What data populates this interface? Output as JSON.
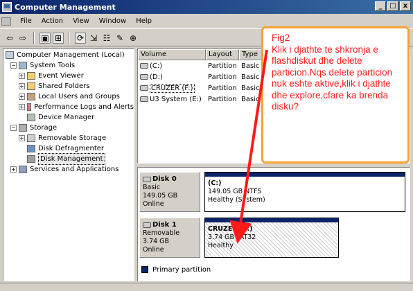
{
  "window": {
    "title": "Computer Management",
    "buttons": [
      "_",
      "□",
      "x"
    ]
  },
  "menu": [
    "File",
    "Action",
    "View",
    "Window",
    "Help"
  ],
  "toolbar": {
    "icons": [
      "back-icon",
      "forward-icon",
      "up-icon",
      "show-hide-tree-icon",
      "refresh-icon",
      "export-icon",
      "properties-icon",
      "help-icon",
      "zoom-in-icon"
    ],
    "glyphs": [
      "⇦",
      "⇨",
      "▣",
      "⊞",
      "⟳",
      "⇲",
      "☷",
      "✎",
      "⊕"
    ]
  },
  "tree": {
    "items": [
      {
        "label": "Computer Management (Local)"
      },
      {
        "label": "System Tools"
      },
      {
        "label": "Event Viewer"
      },
      {
        "label": "Shared Folders"
      },
      {
        "label": "Local Users and Groups"
      },
      {
        "label": "Performance Logs and Alerts"
      },
      {
        "label": "Device Manager"
      },
      {
        "label": "Storage"
      },
      {
        "label": "Removable Storage"
      },
      {
        "label": "Disk Defragmenter"
      },
      {
        "label": "Disk Management"
      },
      {
        "label": "Services and Applications"
      }
    ]
  },
  "volumes": {
    "headers": [
      "Volume",
      "Layout",
      "Type"
    ],
    "rows": [
      {
        "volume": "(C:)",
        "layout": "Partition",
        "type": "Basic"
      },
      {
        "volume": "(D:)",
        "layout": "Partition",
        "type": "Basic"
      },
      {
        "volume": "CRUZER (F:)",
        "layout": "Partition",
        "type": "Basic"
      },
      {
        "volume": "U3 System (E:)",
        "layout": "Partition",
        "type": "Basic"
      }
    ]
  },
  "disks": [
    {
      "name": "Disk 0",
      "kind": "Basic",
      "size": "149.05 GB",
      "status": "Online",
      "partition": {
        "name": "(C:)",
        "size": "149.05 GB NTFS",
        "health": "Healthy (System)"
      }
    },
    {
      "name": "Disk 1",
      "kind": "Removable",
      "size": "3.74 GB",
      "status": "Online",
      "partition": {
        "name": "CRUZER  (F:)",
        "size": "3.74 GB FAT32",
        "health": "Healthy"
      }
    }
  ],
  "legend": {
    "label": "Primary partition",
    "color": "#0a246a"
  },
  "annotation": {
    "title": "Fig2",
    "text": "Klik i djathte te shkronja e flashdiskut dhe delete particion.Nqs delete particion nuk eshte aktive,klik i djathte dhe explore,cfare ka brenda disku?",
    "color": "#ff1a1a",
    "border_color": "#f7a22e"
  }
}
